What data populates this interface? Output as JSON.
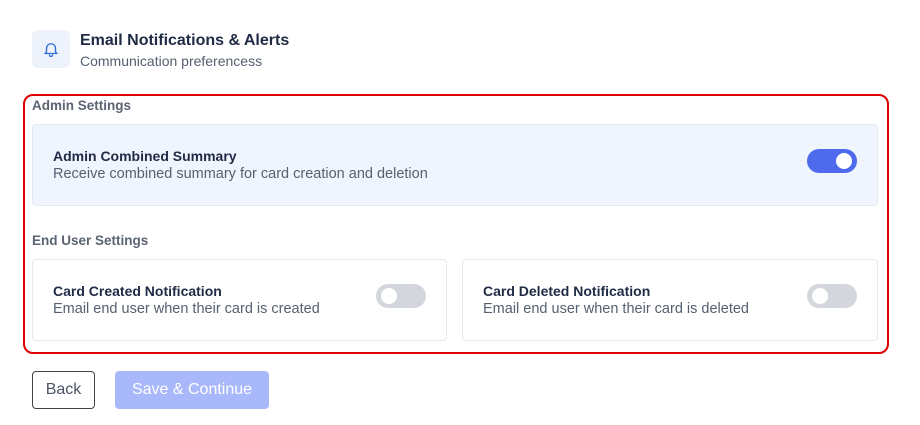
{
  "header": {
    "icon": "bell-icon",
    "title": "Email Notifications & Alerts",
    "subtitle": "Communication preferencess"
  },
  "admin_section": {
    "label": "Admin Settings",
    "items": [
      {
        "title": "Admin Combined Summary",
        "description": "Receive combined summary for card creation and deletion",
        "enabled": true
      }
    ]
  },
  "end_user_section": {
    "label": "End User Settings",
    "items": [
      {
        "title": "Card Created Notification",
        "description": "Email end user when their card is created",
        "enabled": false
      },
      {
        "title": "Card Deleted Notification",
        "description": "Email end user when their card is deleted",
        "enabled": false
      }
    ]
  },
  "actions": {
    "back_label": "Back",
    "save_label": "Save & Continue"
  },
  "colors": {
    "accent": "#4f6bed",
    "highlight_frame": "#e00000",
    "save_disabled": "#a9b8fb"
  }
}
